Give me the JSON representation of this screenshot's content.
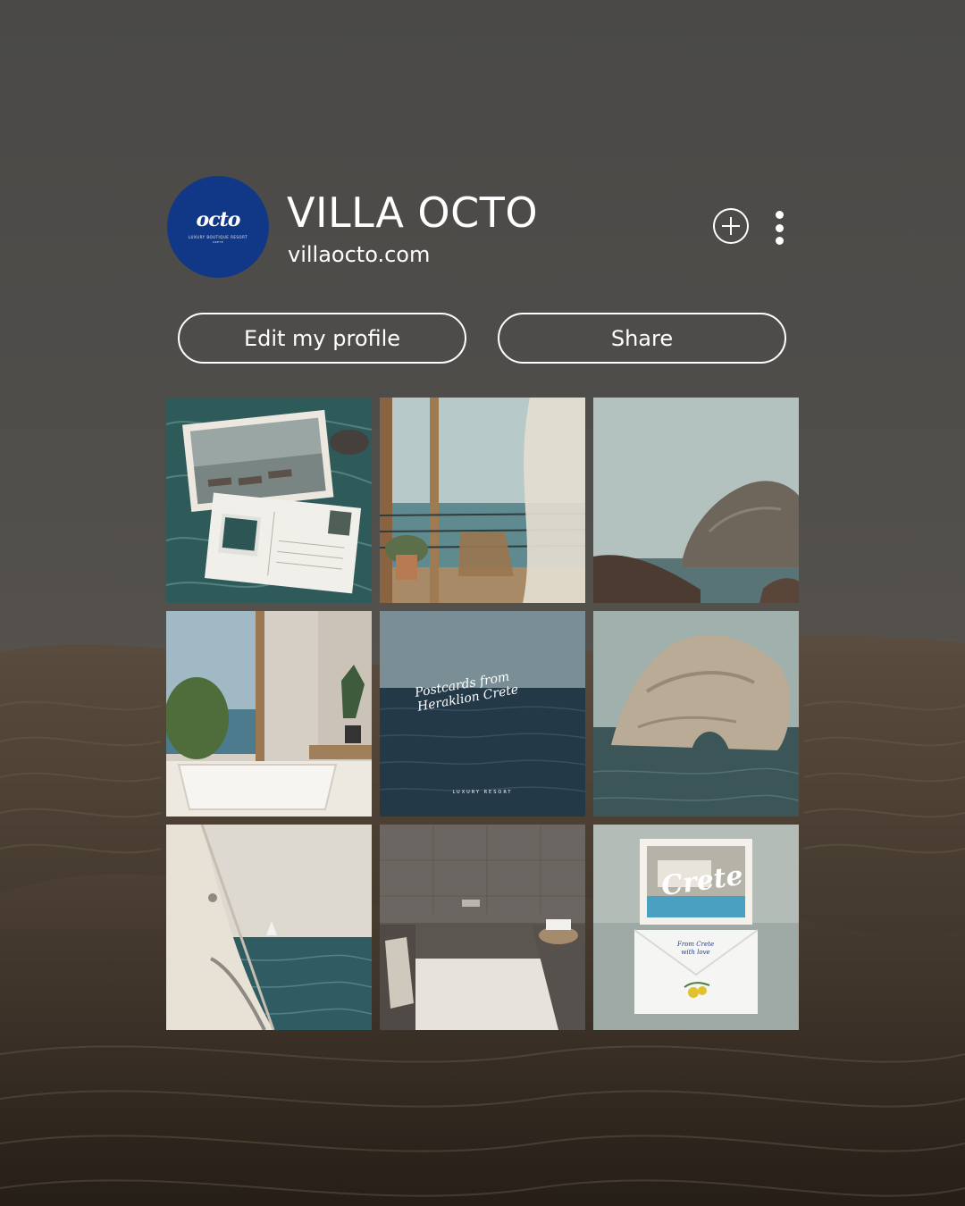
{
  "profile": {
    "name": "VILLA OCTO",
    "website": "villaocto.com",
    "avatar": {
      "logo_text": "octo",
      "logo_subtext": "LUXURY BOUTIQUE RESORT",
      "logo_subtext2": "CRETE",
      "background_color": "#113887"
    }
  },
  "actions": {
    "add_icon": "plus-circle-icon",
    "more_icon": "vertical-ellipsis-icon",
    "edit_label": "Edit my profile",
    "share_label": "Share"
  },
  "grid": {
    "posts": [
      {
        "subject": "postcard collage over pool water"
      },
      {
        "subject": "balcony with linen curtain and sea view"
      },
      {
        "subject": "rocky cliff by the sea"
      },
      {
        "subject": "bathtub by window with sea view"
      },
      {
        "subject": "open sea",
        "overlay_text": "Postcards from\nHeraklion Crete",
        "overlay_small": "LUXURY RESORT"
      },
      {
        "subject": "rock arch in the sea"
      },
      {
        "subject": "sailboat rigging over the sea"
      },
      {
        "subject": "steam bath interior"
      },
      {
        "subject": "postcard and envelope collage",
        "overlay_text": "Crete",
        "overlay_small": "From Crete\nwith love"
      }
    ]
  },
  "colors": {
    "text": "#ffffff",
    "outline": "#ffffff",
    "brand_blue": "#113887"
  }
}
